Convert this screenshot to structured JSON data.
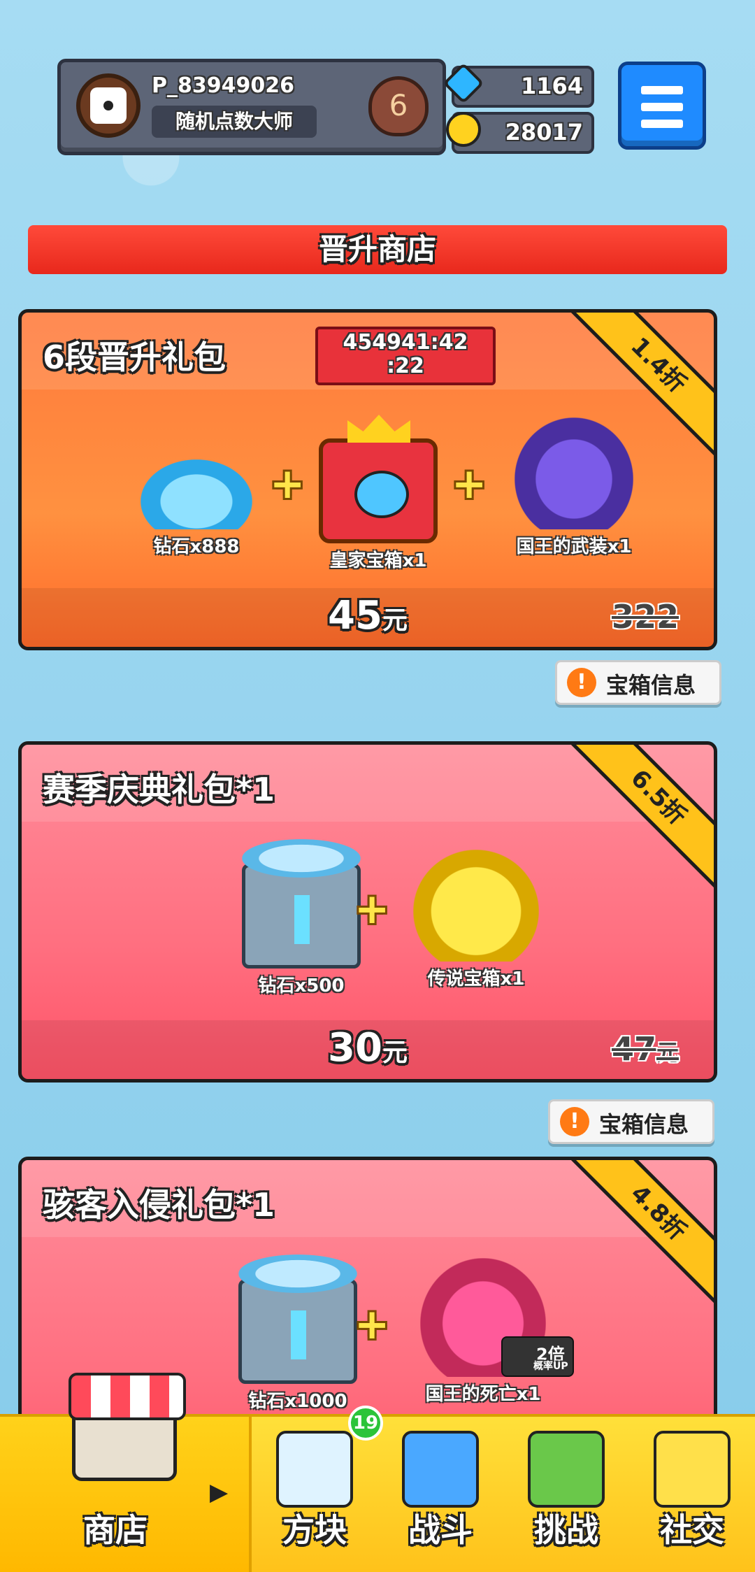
{
  "player": {
    "id": "P_83949026",
    "title": "随机点数大师",
    "rank": "6"
  },
  "currency": {
    "gems": "1164",
    "coins": "28017"
  },
  "shop_title": "晋升商店",
  "packs": [
    {
      "title": "6段晋升礼包",
      "timer": "454941:42\n:22",
      "discount": "1.4折",
      "items": [
        "钻石x888",
        "皇家宝箱x1",
        "国王的武装x1"
      ],
      "price": "45",
      "price_unit": "元",
      "original_price": "322",
      "original_unit": ""
    },
    {
      "title": "赛季庆典礼包*1",
      "discount": "6.5折",
      "items": [
        "钻石x500",
        "传说宝箱x1"
      ],
      "price": "30",
      "price_unit": "元",
      "original_price": "47",
      "original_unit": "元"
    },
    {
      "title": "骇客入侵礼包*1",
      "discount": "4.8折",
      "items": [
        "钻石x1000",
        "国王的死亡x1"
      ],
      "badge": {
        "multiplier": "2倍",
        "text": "概率UP"
      }
    }
  ],
  "info_button": {
    "label": "宝箱信息",
    "icon": "!"
  },
  "nav": {
    "items": [
      "商店",
      "方块",
      "战斗",
      "挑战",
      "社交"
    ],
    "badge_count": "19"
  },
  "colors": {
    "shop_banner": "#ff3a2a",
    "pack1_bg": "#ff8040",
    "pack_pink_bg": "#ff7080",
    "ribbon": "#ffc21a",
    "nav_bg": "#ffd21f",
    "menu_btn": "#1f8bff"
  }
}
